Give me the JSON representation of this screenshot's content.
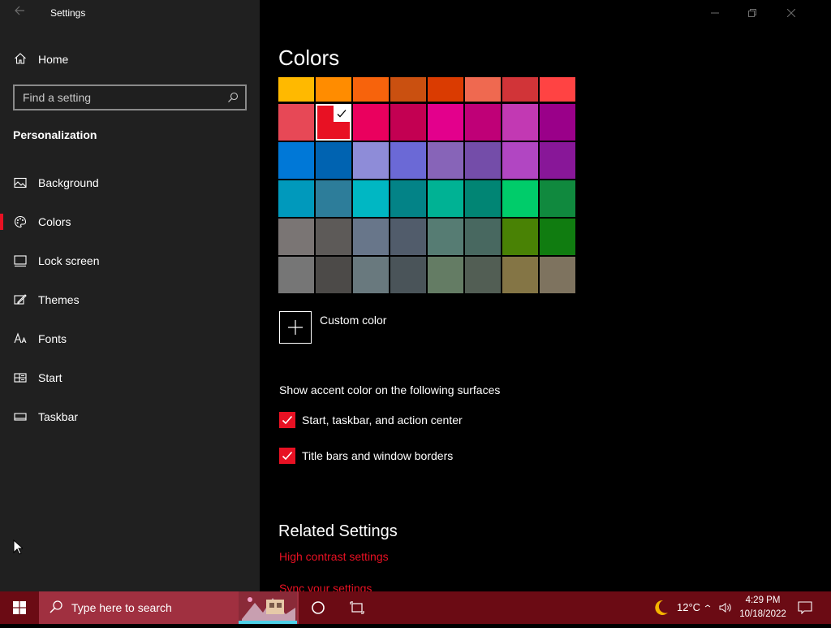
{
  "window": {
    "title": "Settings"
  },
  "sidebar": {
    "home_label": "Home",
    "search_placeholder": "Find a setting",
    "section_heading": "Personalization",
    "items": [
      {
        "label": "Background",
        "icon": "picture-icon",
        "selected": false
      },
      {
        "label": "Colors",
        "icon": "palette-icon",
        "selected": true
      },
      {
        "label": "Lock screen",
        "icon": "lock-screen-icon",
        "selected": false
      },
      {
        "label": "Themes",
        "icon": "themes-icon",
        "selected": false
      },
      {
        "label": "Fonts",
        "icon": "fonts-icon",
        "selected": false
      },
      {
        "label": "Start",
        "icon": "start-icon",
        "selected": false
      },
      {
        "label": "Taskbar",
        "icon": "taskbar-icon",
        "selected": false
      }
    ]
  },
  "main": {
    "title": "Colors",
    "accent_colors": [
      [
        "#ffb900",
        "#ff8c00",
        "#f7630c",
        "#ca5010",
        "#da3b01",
        "#ef6950",
        "#d13438",
        "#ff4343"
      ],
      [
        "#e74856",
        "#e81123",
        "#ea005e",
        "#c30052",
        "#e3008c",
        "#bf0077",
        "#c239b3",
        "#9a0089"
      ],
      [
        "#0078d7",
        "#0063b1",
        "#8e8cd8",
        "#6b69d6",
        "#8764b8",
        "#744da9",
        "#b146c2",
        "#881798"
      ],
      [
        "#0099bc",
        "#2d7d9a",
        "#00b7c3",
        "#038387",
        "#00b294",
        "#018574",
        "#00cc6a",
        "#10893e"
      ],
      [
        "#7a7574",
        "#5d5a58",
        "#68768a",
        "#515c6b",
        "#567c73",
        "#486860",
        "#498205",
        "#107c10"
      ],
      [
        "#767676",
        "#4c4a48",
        "#69797e",
        "#4a5459",
        "#647c64",
        "#525e54",
        "#847545",
        "#7e735f"
      ]
    ],
    "selected_color": "#e81123",
    "custom_color_label": "Custom color",
    "surfaces_heading": "Show accent color on the following surfaces",
    "surfaces": [
      {
        "label": "Start, taskbar, and action center",
        "checked": true
      },
      {
        "label": "Title bars and window borders",
        "checked": true
      }
    ],
    "related_heading": "Related Settings",
    "related_links": [
      "High contrast settings",
      "Sync your settings"
    ]
  },
  "taskbar": {
    "search_placeholder": "Type here to search",
    "temperature": "12°C",
    "time": "4:29 PM",
    "date": "10/18/2022"
  },
  "colors": {
    "sidebar_bg": "#202020",
    "content_bg": "#000000",
    "accent": "#e81123",
    "taskbar_bg": "#6b0b14"
  }
}
